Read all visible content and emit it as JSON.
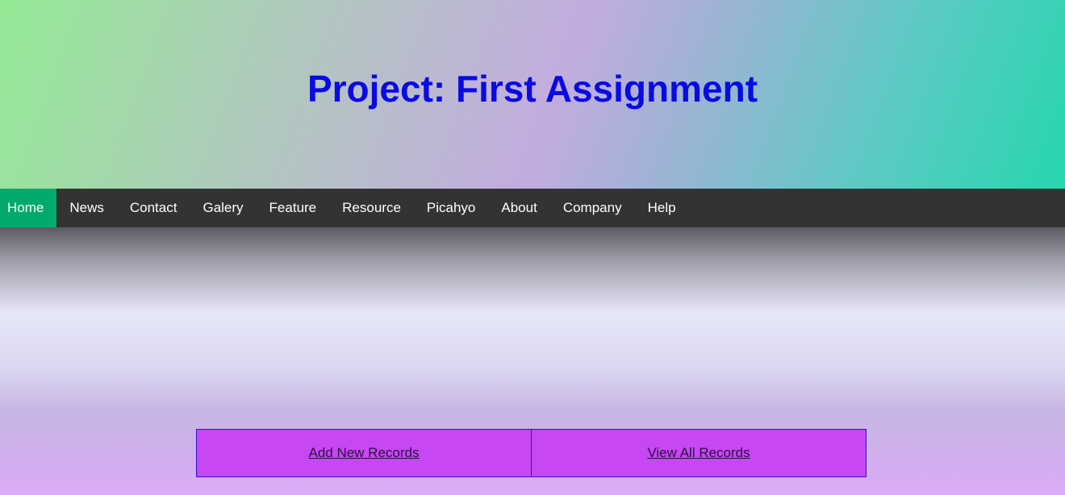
{
  "header": {
    "title": "Project: First Assignment"
  },
  "nav": {
    "items": [
      {
        "label": "Home",
        "active": true
      },
      {
        "label": "News"
      },
      {
        "label": "Contact"
      },
      {
        "label": "Galery"
      },
      {
        "label": "Feature"
      },
      {
        "label": "Resource"
      },
      {
        "label": "Picahyo"
      },
      {
        "label": "About"
      },
      {
        "label": "Company"
      },
      {
        "label": "Help"
      }
    ]
  },
  "actions": {
    "add_label": "Add New Records",
    "view_label": "View All Records"
  },
  "colors": {
    "title": "#0a0ae4",
    "nav_background": "#333333",
    "nav_active": "#04aa6d",
    "action_background": "#c747f2",
    "action_border": "#3310c8"
  }
}
